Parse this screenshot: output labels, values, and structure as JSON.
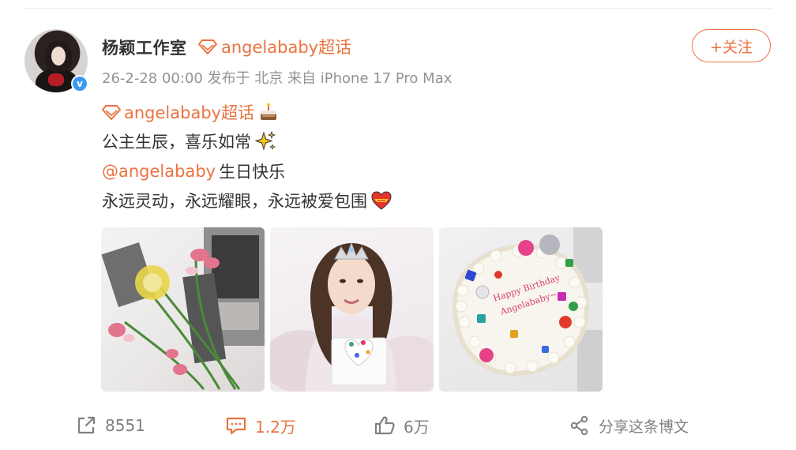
{
  "post": {
    "author": "杨颖工作室",
    "topic_head": "angelababy超话",
    "date": "26-2-28 00:00",
    "posted_from": "发布于 北京",
    "device": "来自 iPhone 17 Pro Max",
    "follow_label": "+关注",
    "verified_badge": "v",
    "topic_line": "angelababy超话",
    "line2": "公主生辰，喜乐如常",
    "mention": "@angelababy",
    "line3_rest": "生日快乐",
    "line4": "永远灵动，永远耀眼，永远被爱包围"
  },
  "photos": [
    {
      "subject": "flowers-and-photos"
    },
    {
      "subject": "woman-with-tiara-and-cake"
    },
    {
      "subject": "decorated-birthday-cake"
    }
  ],
  "cake_text": "Happy Birthday Angelababy",
  "actions": {
    "forward": "8551",
    "comment": "1.2万",
    "like": "6万",
    "share": "分享这条博文"
  },
  "colors": {
    "accent": "#eb7340",
    "text": "#333333",
    "muted": "#939393",
    "verified": "#3a9af0"
  },
  "icons": [
    "verified-icon",
    "supertopic-gem-icon",
    "cake-emoji",
    "sparkles-emoji",
    "heart-emoji",
    "forward-icon",
    "comment-icon",
    "like-icon",
    "share-icon"
  ]
}
